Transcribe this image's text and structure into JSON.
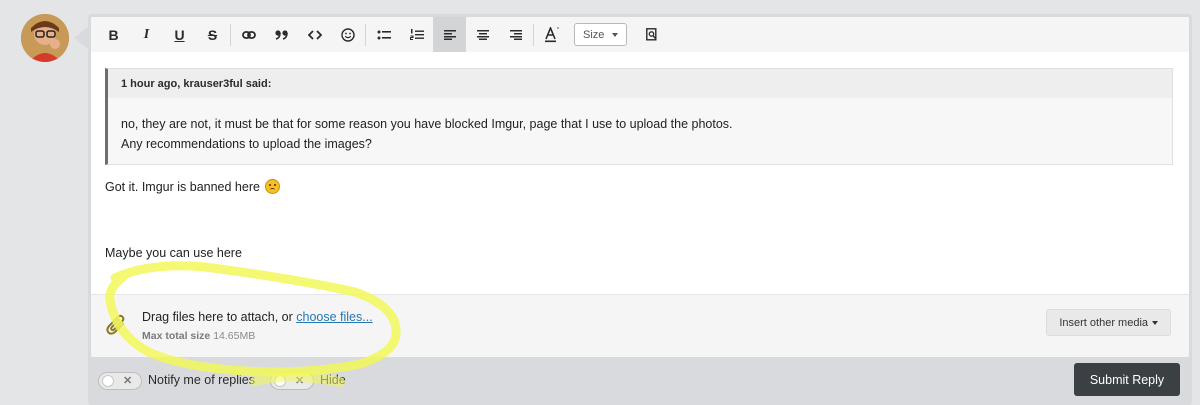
{
  "toolbar": {
    "buttons": [
      "B",
      "I",
      "U",
      "S"
    ],
    "size_label": "Size"
  },
  "quote": {
    "author_line": "1 hour ago, krauser3ful said:",
    "lines": [
      "no, they are not, it must be that for some reason you have blocked Imgur, page that I use to upload the photos.",
      "Any recommendations to upload the images?"
    ]
  },
  "message": {
    "line1": "Got it. Imgur is banned here",
    "line2": "Maybe you can use here"
  },
  "attachments": {
    "prompt_prefix": "Drag files here to attach, or ",
    "choose_link": "choose files...",
    "max_size_label": "Max total size",
    "max_size_value": "14.65MB",
    "insert_media_label": "Insert other media"
  },
  "footer": {
    "notify_label": "Notify me of replies",
    "hide_label": "Hide",
    "submit_label": "Submit Reply"
  },
  "colors": {
    "highlight": "#f2f75a",
    "submit_bg": "#3b4045",
    "link": "#2577b1"
  },
  "icons": [
    "link-icon",
    "quote-icon",
    "code-icon",
    "smiley-icon",
    "bullet-list-icon",
    "numbered-list-icon",
    "align-left-icon",
    "align-center-icon",
    "align-right-icon",
    "text-color-icon",
    "preview-icon",
    "paperclip-icon",
    "emoji-icon"
  ]
}
